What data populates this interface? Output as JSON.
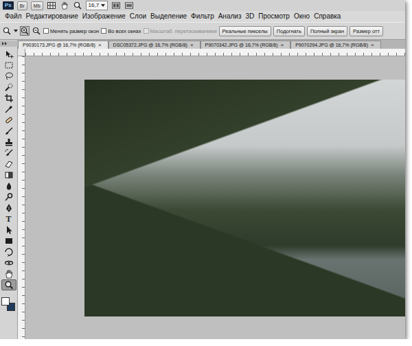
{
  "app": {
    "logo": "Ps",
    "launchers": [
      "Br",
      "Mb"
    ],
    "zoom": "16,7"
  },
  "menu": [
    "Файл",
    "Редактирование",
    "Изображение",
    "Слои",
    "Выделение",
    "Фильтр",
    "Анализ",
    "3D",
    "Просмотр",
    "Окно",
    "Справка"
  ],
  "options_bar": {
    "checkboxes": [
      {
        "label": "Менять размер окон",
        "checked": false,
        "disabled": false
      },
      {
        "label": "Во всех окнах",
        "checked": false,
        "disabled": false
      },
      {
        "label": "Масштаб. перетаскиванием",
        "checked": false,
        "disabled": true
      }
    ],
    "buttons": [
      "Реальные пикселы",
      "Подогнать",
      "Полный экран",
      "Размер отт"
    ]
  },
  "tabs": [
    {
      "label": "P9030173.JPG @ 16,7% (RGB/8)",
      "close": "×",
      "selected": true
    },
    {
      "label": "DSC05372.JPG @ 16,7% (RGB/8)",
      "close": "×",
      "selected": false
    },
    {
      "label": "P9070342.JPG @ 16,7% (RGB/8)",
      "close": "×",
      "selected": false
    },
    {
      "label": "P9070294.JPG @ 16,7% (RGB/8)",
      "close": "×",
      "selected": false
    }
  ],
  "toolbox": {
    "tools": [
      {
        "kind": "move",
        "selected": false
      },
      {
        "kind": "marquee",
        "selected": false
      },
      {
        "kind": "lasso",
        "selected": false
      },
      {
        "kind": "quickselect",
        "selected": false
      },
      {
        "kind": "crop",
        "selected": false
      },
      {
        "kind": "eyedropper",
        "selected": false
      },
      {
        "kind": "healing",
        "selected": false
      },
      {
        "kind": "brush",
        "selected": false
      },
      {
        "kind": "stamp",
        "selected": false
      },
      {
        "kind": "historybrush",
        "selected": false
      },
      {
        "kind": "eraser",
        "selected": false
      },
      {
        "kind": "gradient",
        "selected": false
      },
      {
        "kind": "blur",
        "selected": false
      },
      {
        "kind": "dodge",
        "selected": false
      },
      {
        "kind": "pen",
        "selected": false
      },
      {
        "kind": "type",
        "glyph": "T",
        "selected": false
      },
      {
        "kind": "pathselect",
        "selected": false
      },
      {
        "kind": "shape",
        "selected": false
      },
      {
        "kind": "rotate3d",
        "selected": false
      },
      {
        "kind": "orbit3d",
        "selected": false
      },
      {
        "kind": "hand",
        "selected": false
      },
      {
        "kind": "zoom",
        "selected": true
      }
    ],
    "swatches": [
      {
        "kind": "foreground",
        "color": "#ffffff"
      },
      {
        "kind": "background",
        "color": "#1f3a5c"
      }
    ]
  }
}
